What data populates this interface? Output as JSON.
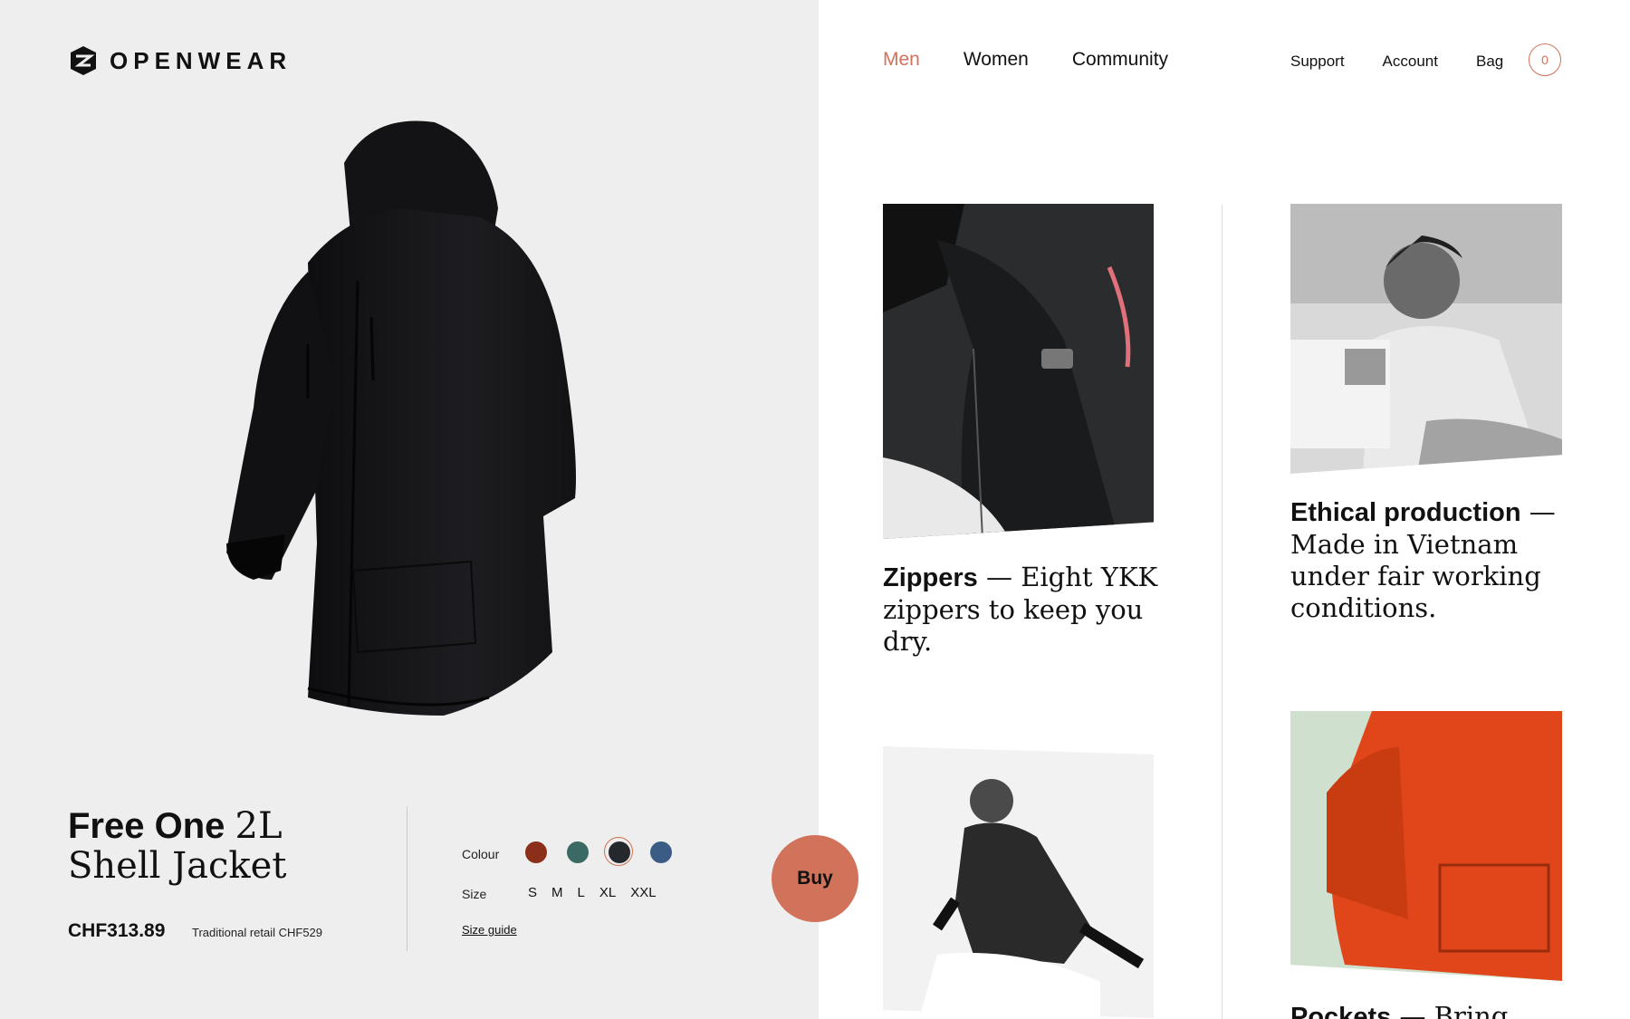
{
  "brand": {
    "name": "OPENWEAR",
    "icon": "openwear-logo-icon"
  },
  "nav": {
    "main": [
      "Men",
      "Women",
      "Community"
    ],
    "active": "Men",
    "utility": [
      "Support",
      "Account",
      "Bag"
    ],
    "bag_count": "0"
  },
  "product": {
    "title_bold": "Free One",
    "title_serif": "2L",
    "title_line2": "Shell Jacket",
    "price": "CHF313.89",
    "retail": "Traditional retail CHF529",
    "colour_label": "Colour",
    "colours": [
      "#8b2e1a",
      "#3a6a63",
      "#25282d",
      "#3b5d85"
    ],
    "selected_colour_index": 2,
    "size_label": "Size",
    "sizes": [
      "S",
      "M",
      "L",
      "XL",
      "XXL"
    ],
    "size_guide": "Size guide",
    "buy_label": "Buy"
  },
  "features": [
    {
      "title": "Zippers",
      "dash": "—",
      "text": "Eight YKK zippers to keep you dry."
    },
    {
      "title": "Ethical production",
      "dash": "—",
      "text": "Made in Vietnam under fair working conditions."
    },
    {
      "title": "Pockets",
      "dash": "—",
      "text": "Bring"
    }
  ]
}
